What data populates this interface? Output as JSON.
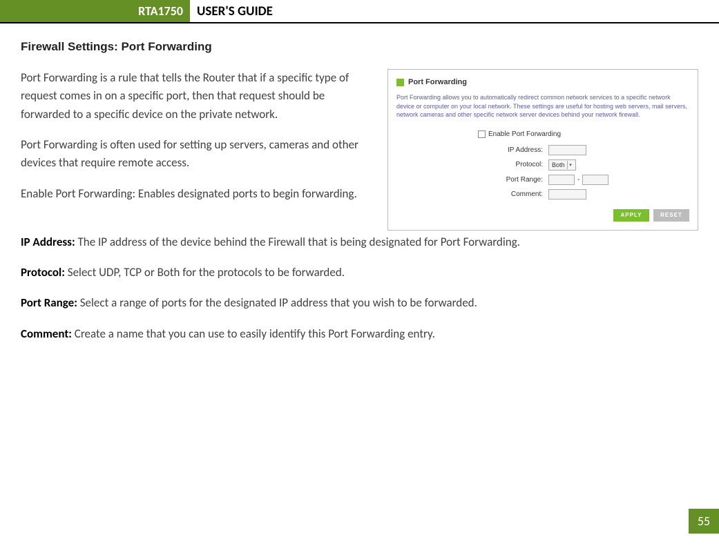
{
  "header": {
    "model": "RTA1750",
    "title": "USER'S GUIDE"
  },
  "section_heading": "Firewall Settings: Port Forwarding",
  "paragraphs": {
    "p1": "Port Forwarding is a rule that tells the Router that if a specific type of request comes in on a specific port, then that request should be forwarded to a specific device on the private network.",
    "p2": "Port Forwarding is often used for setting up servers, cameras and other devices that require remote access.",
    "p3": "Enable Port Forwarding: Enables designated ports to begin forwarding."
  },
  "panel": {
    "title": "Port Forwarding",
    "desc": "Port Forwarding allows you to automatically redirect common network services to a specific network device or computer on your local network. These settings are useful for hosting web servers, mail servers, network cameras and other specific network server devices behind your network firewall.",
    "enable_label": "Enable Port Forwarding",
    "fields": {
      "ip": "IP Address:",
      "protocol": "Protocol:",
      "protocol_value": "Both",
      "port_range": "Port Range:",
      "dash": "-",
      "comment": "Comment:"
    },
    "buttons": {
      "apply": "APPLY",
      "reset": "RESET"
    }
  },
  "definitions": {
    "ip_label": "IP Address:",
    "ip_text": "  The IP address of the device behind the Firewall that is being designated for Port Forwarding.",
    "protocol_label": "Protocol:",
    "protocol_text": " Select UDP, TCP or Both for the protocols to be forwarded.",
    "portrange_label": "Port Range:",
    "portrange_text": " Select a range of ports for the designated IP address that you wish to be forwarded.",
    "comment_label": "Comment:",
    "comment_text": " Create a name that you can use to easily identify this Port Forwarding entry."
  },
  "page_number": "55"
}
